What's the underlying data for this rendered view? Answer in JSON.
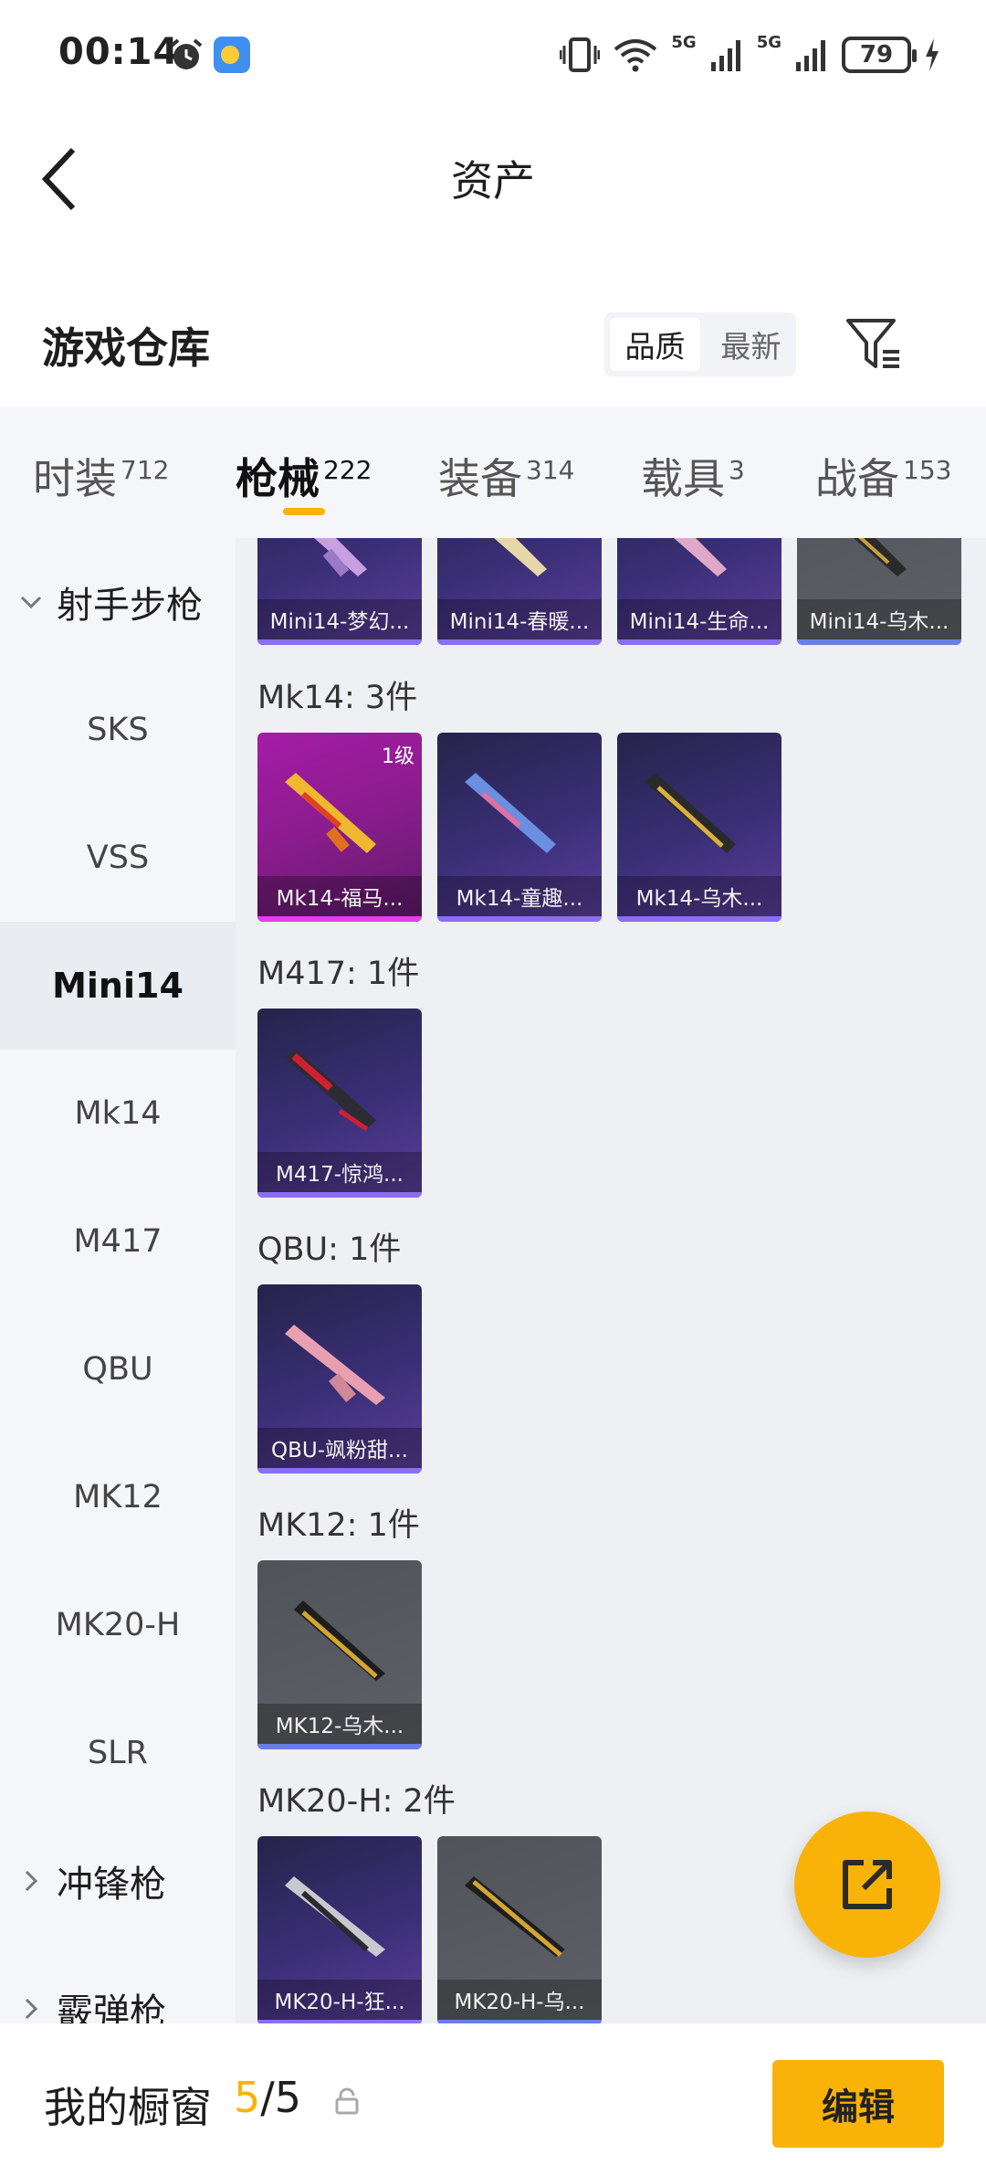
{
  "status_bar": {
    "time": "00:14",
    "network_1": "5G",
    "network_2": "5G",
    "battery": "79"
  },
  "header": {
    "title": "资产"
  },
  "section": {
    "title": "游戏仓库",
    "sort_options": [
      "品质",
      "最新"
    ],
    "sort_selected": "品质"
  },
  "tabs": [
    {
      "label": "时装",
      "count": "712"
    },
    {
      "label": "枪械",
      "count": "222"
    },
    {
      "label": "装备",
      "count": "314"
    },
    {
      "label": "载具",
      "count": "3"
    },
    {
      "label": "战备",
      "count": "153"
    }
  ],
  "active_tab": "枪械",
  "sidebar": {
    "items": [
      {
        "label": "射手步枪"
      },
      {
        "label": "SKS"
      },
      {
        "label": "VSS"
      },
      {
        "label": "Mini14"
      },
      {
        "label": "Mk14"
      },
      {
        "label": "M417"
      },
      {
        "label": "QBU"
      },
      {
        "label": "MK12"
      },
      {
        "label": "MK20-H"
      },
      {
        "label": "SLR"
      },
      {
        "label": "冲锋枪"
      },
      {
        "label": "霰弹枪"
      }
    ],
    "active": "Mini14"
  },
  "content": {
    "top_row": [
      {
        "name": "Mini14-梦幻...",
        "rarity": "purple"
      },
      {
        "name": "Mini14-春暖...",
        "rarity": "purple"
      },
      {
        "name": "Mini14-生命...",
        "rarity": "purple"
      },
      {
        "name": "Mini14-乌木...",
        "rarity": "gray"
      }
    ],
    "groups": [
      {
        "label": "Mk14: 3件",
        "items": [
          {
            "name": "Mk14-福马...",
            "rarity": "magenta",
            "tier": "1级"
          },
          {
            "name": "Mk14-童趣...",
            "rarity": "purple"
          },
          {
            "name": "Mk14-乌木...",
            "rarity": "purple"
          }
        ]
      },
      {
        "label": "M417: 1件",
        "items": [
          {
            "name": "M417-惊鸿...",
            "rarity": "purple"
          }
        ]
      },
      {
        "label": "QBU: 1件",
        "items": [
          {
            "name": "QBU-飒粉甜...",
            "rarity": "purple"
          }
        ]
      },
      {
        "label": "MK12: 1件",
        "items": [
          {
            "name": "MK12-乌木...",
            "rarity": "gray"
          }
        ]
      },
      {
        "label": "MK20-H: 2件",
        "items": [
          {
            "name": "MK20-H-狂...",
            "rarity": "purple"
          },
          {
            "name": "MK20-H-乌...",
            "rarity": "gray"
          }
        ]
      }
    ]
  },
  "bottom_bar": {
    "label": "我的橱窗",
    "current": "5",
    "separator": "/",
    "total": "5",
    "edit_label": "编辑"
  },
  "colors": {
    "accent": "#f9b208",
    "purple_card": "#3b2f78",
    "magenta_card": "#a41ca6",
    "gray_card": "#5a5d63"
  }
}
